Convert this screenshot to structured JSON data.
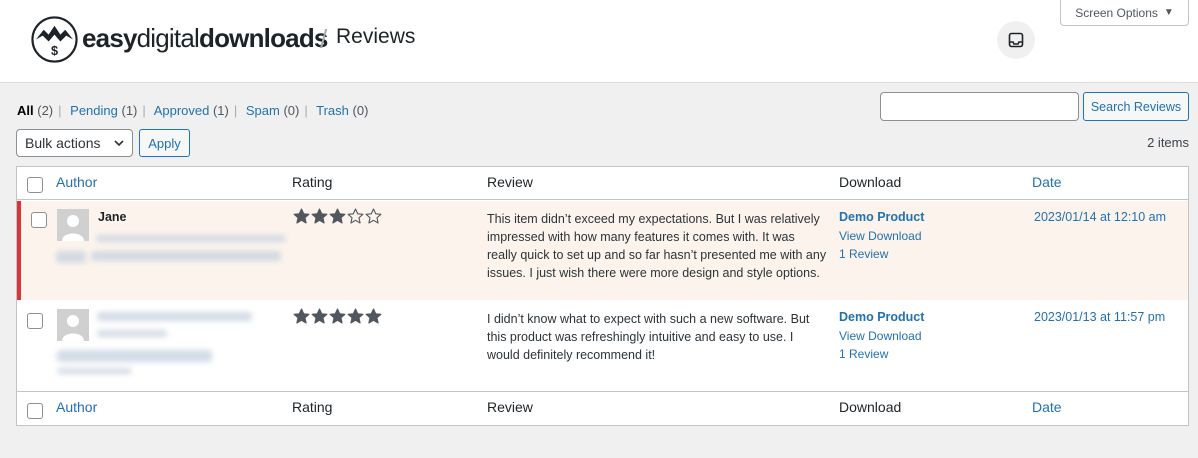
{
  "header": {
    "brand_bold1": "easy",
    "brand_light": "digital",
    "brand_bold2": "downloads",
    "separator": "/",
    "page_title": "Reviews",
    "screen_options_label": "Screen Options"
  },
  "filters": [
    {
      "label": "All",
      "count": "(2)",
      "current": true
    },
    {
      "label": "Pending",
      "count": "(1)"
    },
    {
      "label": "Approved",
      "count": "(1)"
    },
    {
      "label": "Spam",
      "count": "(0)"
    },
    {
      "label": "Trash",
      "count": "(0)"
    }
  ],
  "search": {
    "button_label": "Search Reviews",
    "value": ""
  },
  "bulk": {
    "select_label": "Bulk actions",
    "apply_label": "Apply"
  },
  "items_count": "2 items",
  "columns": {
    "author": "Author",
    "rating": "Rating",
    "review": "Review",
    "download": "Download",
    "date": "Date"
  },
  "rows": [
    {
      "author": "Jane",
      "rating": 3,
      "review": "This item didn’t exceed my expectations. But I was relatively impressed with how many features it comes with. It was really quick to set up and so far hasn’t presented me with any issues. I just wish there were more design and style options.",
      "download_title": "Demo Product",
      "view_download": "View Download",
      "review_count": "1 Review",
      "date": "2023/01/14 at 12:10 am",
      "status": "pending"
    },
    {
      "author": "",
      "rating": 5,
      "review": "I didn’t know what to expect with such a new software. But this product was refreshingly intuitive and easy to use. I would definitely recommend it!",
      "download_title": "Demo Product",
      "view_download": "View Download",
      "review_count": "1 Review",
      "date": "2023/01/13 at 11:57 pm",
      "status": "approved"
    }
  ],
  "colors": {
    "accent": "#2271b1",
    "pending_border": "#d63638",
    "pending_bg": "#fcf4ec",
    "star": "#50575e"
  }
}
